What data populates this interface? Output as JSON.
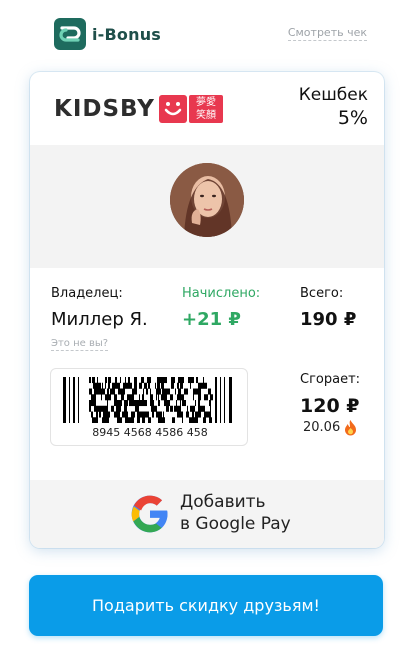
{
  "header": {
    "logo_text": "i-Bonus",
    "view_receipt": "Смотреть чек"
  },
  "card": {
    "brand": {
      "name": "KIDSBY",
      "chinese": "夢愛\n笑顏"
    },
    "cashback": {
      "label": "Кешбек",
      "value": "5%"
    },
    "owner": {
      "label": "Владелец:",
      "value": "Миллер Я.",
      "not_you": "Это не вы?"
    },
    "accrued": {
      "label": "Начислено:",
      "value": "+21 ₽",
      "color": "#2fa863"
    },
    "total": {
      "label": "Всего:",
      "value": "190 ₽"
    },
    "barcode": {
      "number": "8945 4568 4586 458"
    },
    "expires": {
      "label": "Сгорает:",
      "value": "120 ₽",
      "date": "20.06",
      "icon": "fire-icon"
    },
    "google_pay": {
      "line1": "Добавить",
      "line2": "в Google Pay",
      "icon": "google-g-icon"
    }
  },
  "gift_button": {
    "label": "Подарить скидку друзьям!",
    "color": "#0a9ce8"
  }
}
